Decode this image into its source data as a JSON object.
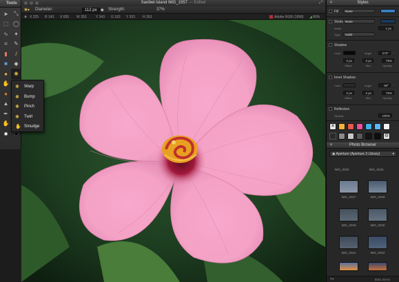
{
  "window": {
    "title": "Sanibel Island IMG_1557",
    "edited": "— Edited"
  },
  "tools_panel": {
    "title": "Tools",
    "distort_menu": [
      "Warp",
      "Bump",
      "Pinch",
      "Twirl",
      "Smudge"
    ]
  },
  "options": {
    "diameter_label": "Diameter:",
    "diameter_value": "112 px",
    "strength_label": "Strength:",
    "strength_value": "37%"
  },
  "info": {
    "x": "X 225",
    "r": "R 143",
    "x2": "X 655",
    "w": "W 353",
    "y": "Y 343",
    "g": "G 183",
    "y2": "Y 353",
    "h": "H 353",
    "colorspace": "Adobe RGB (1998)",
    "zoom": "80%"
  },
  "styles_panel": {
    "title": "Styles",
    "fill_label": "Fill",
    "fill_value": "None",
    "stroke_label": "Stroke",
    "stroke_value": "None",
    "width_label": "Width",
    "width_value": "1 px",
    "style_label": "Style",
    "style_value": "Solid",
    "shadow_label": "Shadow",
    "shadow_color_label": "Color",
    "shadow_angle_label": "Angle",
    "shadow_angle_value": "270°",
    "shadow_offset_value": "2 px",
    "shadow_blur_value": "2 px",
    "shadow_opacity_value": "75%",
    "offset_label": "Offset",
    "blur_label": "Blur",
    "opacity_label": "Opacity",
    "inner_shadow_label": "Inner Shadow",
    "inner_color_label": "Color",
    "inner_angle_label": "Angle",
    "inner_angle_value": "90°",
    "inner_offset_value": "2 px",
    "inner_blur_value": "2 px",
    "inner_opacity_value": "75%",
    "reflection_label": "Reflection",
    "reflection_opacity_label": "Opacity",
    "reflection_opacity_value": "100%",
    "preset_colors_row1": [
      "#e8e8e8",
      "#f3b43a",
      "#e8584c",
      "#e94f9b",
      "#3db1e8",
      "#5bb8f2",
      "#f2f2f2"
    ],
    "preset_colors_row2": [
      "#2a2a2a",
      "#8a8a8a",
      "#c9c9c9",
      "#595959",
      "#151515",
      "#0d0d0d",
      "#e0e0e0"
    ]
  },
  "photo_browser": {
    "title": "Photo Browser",
    "source": "Aperture (Aperture 3 Library)",
    "items": [
      "IMG_0025",
      "IMG_0026",
      "IMG_0027",
      "IMG_0028",
      "IMG_0029",
      "IMG_0030",
      "IMG_0031",
      "IMG_0032"
    ],
    "footer": "8051 Items"
  }
}
